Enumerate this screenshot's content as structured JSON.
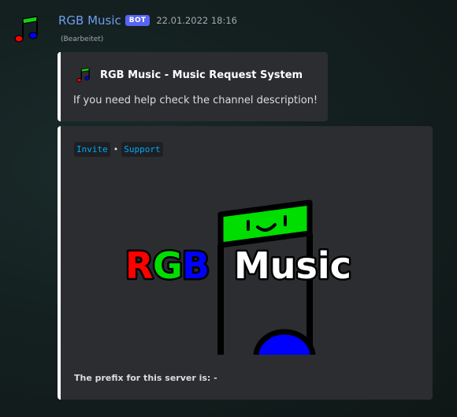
{
  "message": {
    "username": "RGB Music",
    "bot_tag": "BOT",
    "timestamp": "22.01.2022 18:16",
    "edited": "(Bearbeitet)"
  },
  "embed1": {
    "author_name": "RGB Music - Music Request System",
    "description": "If you need help check the channel description!",
    "border_color": "#ffffff"
  },
  "embed2": {
    "links": [
      {
        "label": "Invite"
      },
      {
        "label": "Support"
      }
    ],
    "separator": "•",
    "banner_text": {
      "r": "R",
      "g": "G",
      "b": "B",
      "music": "Music"
    },
    "footer_text": "The prefix for this server is: -"
  },
  "colors": {
    "red": "#ff0000",
    "green": "#00e000",
    "blue": "#0000ff",
    "link": "#00a8fc",
    "username": "#6f9df0",
    "bot_tag": "#5865f2"
  }
}
